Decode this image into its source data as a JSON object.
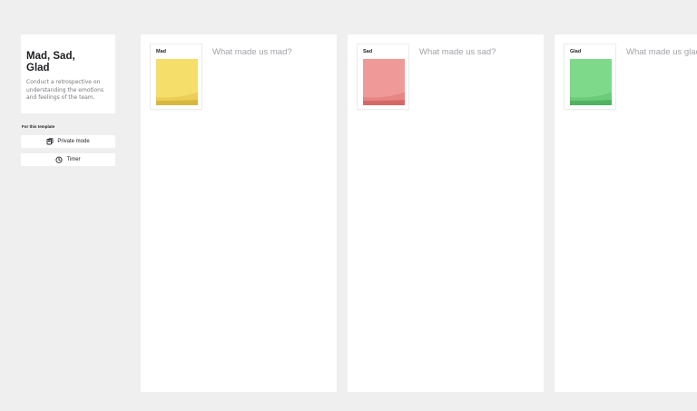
{
  "template": {
    "title": "Mad, Sad,\nGlad",
    "description": "Conduct a retrospective on understanding the emotions and feelings of the team."
  },
  "tools": {
    "section_label": "For this template",
    "private_mode_label": "Private mode",
    "timer_label": "Timer"
  },
  "columns": [
    {
      "sticker_label": "Mad",
      "prompt": "What made us mad?",
      "color": "#f5de6a",
      "shade": "#d6b83e"
    },
    {
      "sticker_label": "Sad",
      "prompt": "What made us sad?",
      "color": "#ef9a98",
      "shade": "#d46a68"
    },
    {
      "sticker_label": "Glad",
      "prompt": "What made us glad?",
      "color": "#7fd98a",
      "shade": "#52b25f"
    }
  ],
  "colors": {
    "background": "#efefef",
    "panel": "#ffffff",
    "prompt_text": "#a3a3a8"
  },
  "icons": [
    "private-mode-icon",
    "timer-icon"
  ]
}
